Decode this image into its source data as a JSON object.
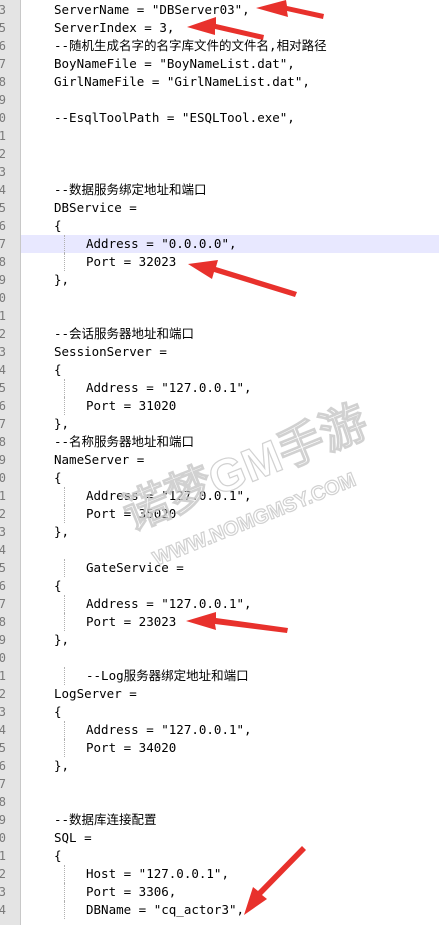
{
  "editor": {
    "lines": [
      {
        "n": "3",
        "text": "ServerName = \"DBServer03\",",
        "indent": false
      },
      {
        "n": "5",
        "text": "ServerIndex = 3,",
        "indent": false
      },
      {
        "n": "6",
        "text": "--随机生成名字的名字库文件的文件名,相对路径",
        "indent": false
      },
      {
        "n": "7",
        "text": "BoyNameFile = \"BoyNameList.dat\",",
        "indent": false
      },
      {
        "n": "8",
        "text": "GirlNameFile = \"GirlNameList.dat\",",
        "indent": false
      },
      {
        "n": "9",
        "text": "",
        "indent": false
      },
      {
        "n": "0",
        "text": "--EsqlToolPath = \"ESQLTool.exe\",",
        "indent": false
      },
      {
        "n": "1",
        "text": "",
        "indent": false
      },
      {
        "n": "2",
        "text": "",
        "indent": false
      },
      {
        "n": "3",
        "text": "",
        "indent": false
      },
      {
        "n": "4",
        "text": "--数据服务绑定地址和端口",
        "indent": false
      },
      {
        "n": "5",
        "text": "DBService =",
        "indent": false
      },
      {
        "n": "6",
        "text": "{",
        "indent": false
      },
      {
        "n": "7",
        "text": "Address = \"0.0.0.0\",",
        "indent": true,
        "highlight": true
      },
      {
        "n": "8",
        "text": "Port = 32023",
        "indent": true
      },
      {
        "n": "9",
        "text": "},",
        "indent": false
      },
      {
        "n": "0",
        "text": "",
        "indent": false
      },
      {
        "n": "1",
        "text": "",
        "indent": false
      },
      {
        "n": "2",
        "text": "--会话服务器地址和端口",
        "indent": false
      },
      {
        "n": "3",
        "text": "SessionServer =",
        "indent": false
      },
      {
        "n": "4",
        "text": "{",
        "indent": false
      },
      {
        "n": "5",
        "text": "Address = \"127.0.0.1\",",
        "indent": true
      },
      {
        "n": "6",
        "text": "Port = 31020",
        "indent": true
      },
      {
        "n": "7",
        "text": "},",
        "indent": false
      },
      {
        "n": "8",
        "text": "--名称服务器地址和端口",
        "indent": false
      },
      {
        "n": "9",
        "text": "NameServer =",
        "indent": false
      },
      {
        "n": "0",
        "text": "{",
        "indent": false
      },
      {
        "n": "1",
        "text": "Address = \"127.0.0.1\",",
        "indent": true
      },
      {
        "n": "2",
        "text": "Port = 35020",
        "indent": true
      },
      {
        "n": "3",
        "text": "},",
        "indent": false
      },
      {
        "n": "4",
        "text": "",
        "indent": false
      },
      {
        "n": "5",
        "text": "GateService =",
        "indent": true
      },
      {
        "n": "6",
        "text": "{",
        "indent": false
      },
      {
        "n": "7",
        "text": "Address = \"127.0.0.1\",",
        "indent": true
      },
      {
        "n": "8",
        "text": "Port = 23023",
        "indent": true
      },
      {
        "n": "9",
        "text": "},",
        "indent": false
      },
      {
        "n": "0",
        "text": "",
        "indent": false
      },
      {
        "n": "1",
        "text": "--Log服务器绑定地址和端口",
        "indent": true
      },
      {
        "n": "2",
        "text": "LogServer =",
        "indent": false
      },
      {
        "n": "3",
        "text": "{",
        "indent": false
      },
      {
        "n": "4",
        "text": "Address = \"127.0.0.1\",",
        "indent": true
      },
      {
        "n": "5",
        "text": "Port = 34020",
        "indent": true
      },
      {
        "n": "6",
        "text": "},",
        "indent": false
      },
      {
        "n": "7",
        "text": "",
        "indent": false
      },
      {
        "n": "8",
        "text": "",
        "indent": false
      },
      {
        "n": "9",
        "text": "--数据库连接配置",
        "indent": false
      },
      {
        "n": "0",
        "text": "SQL =",
        "indent": false
      },
      {
        "n": "1",
        "text": "{",
        "indent": false
      },
      {
        "n": "2",
        "text": "Host = \"127.0.0.1\",",
        "indent": true
      },
      {
        "n": "3",
        "text": "Port = 3306,",
        "indent": true
      },
      {
        "n": "4",
        "text": "DBName = \"cq_actor3\",",
        "indent": true
      }
    ]
  },
  "watermark": {
    "line1": "诺梦GM手游",
    "line2": "WWW.NOMGMSY.COM"
  },
  "colors": {
    "arrow": "#e8312c",
    "current_line": "#e8e8ff",
    "gutter": "#e4e4e4"
  }
}
